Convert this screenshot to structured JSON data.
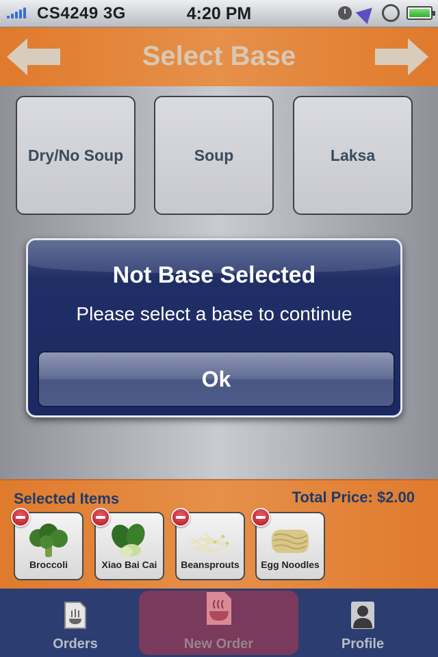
{
  "status_bar": {
    "carrier": "CS4249 3G",
    "time": "4:20 PM",
    "icons": [
      "signal-bars",
      "alarm-icon",
      "location-icon",
      "rotation-lock-icon",
      "battery-icon"
    ]
  },
  "header": {
    "title": "Select Base",
    "back_icon": "arrow-left",
    "next_icon": "arrow-right"
  },
  "bases": [
    {
      "label": "Dry/No Soup"
    },
    {
      "label": "Soup"
    },
    {
      "label": "Laksa"
    }
  ],
  "alert": {
    "title": "Not Base Selected",
    "message": "Please select a base to continue",
    "button": "Ok"
  },
  "selection": {
    "heading": "Selected Items",
    "total_label": "Total Price: $2.00",
    "items": [
      {
        "name": "Broccoli"
      },
      {
        "name": "Xiao Bai Cai"
      },
      {
        "name": "Beansprouts"
      },
      {
        "name": "Egg Noodles"
      }
    ]
  },
  "tabs": [
    {
      "label": "Orders",
      "icon": "orders-icon"
    },
    {
      "label": "New Order",
      "icon": "new-order-icon",
      "active": true
    },
    {
      "label": "Profile",
      "icon": "profile-icon"
    }
  ],
  "colors": {
    "accent_orange": "#e07a2c",
    "alert_navy": "#1b2a62",
    "tab_bar": "#2c3d72",
    "active_tab": "#7a3a5c",
    "label_blue": "#1f3a6a"
  }
}
